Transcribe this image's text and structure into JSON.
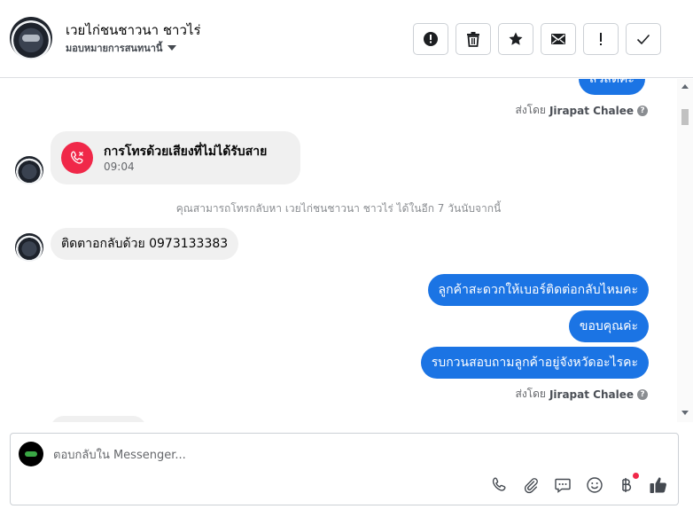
{
  "header": {
    "contact_name": "เวยไก่ชนชาวนา ชาวไร่",
    "assignee_label": "มอบหมายการสนทนานี้",
    "toolbar": [
      {
        "name": "report-button",
        "icon": "alert-circle-icon"
      },
      {
        "name": "delete-button",
        "icon": "trash-icon"
      },
      {
        "name": "star-button",
        "icon": "star-icon"
      },
      {
        "name": "mark-unread-button",
        "icon": "envelope-icon"
      },
      {
        "name": "follow-up-button",
        "icon": "exclamation-icon"
      },
      {
        "name": "mark-done-button",
        "icon": "check-icon"
      }
    ]
  },
  "conversation": {
    "top_partial_bubble": "สวัสดีค่ะ",
    "sent_by_prefix": "ส่งโดย",
    "sent_by_name": "Jirapat Chalee",
    "missed_call": {
      "title": "การโทรด้วยเสียงที่ไม่ได้รับสาย",
      "time": "09:04"
    },
    "callback_note": "คุณสามารถโทรกลับหา เวยไก่ชนชาวนา ชาวไร่ ได้ในอีก 7 วันนับจากนี้",
    "incoming_message": "ติดตาอกลับด้วย 0973133383",
    "outgoing_messages": [
      "ลูกค้าสะดวกให้เบอร์ติดต่อกลับไหมคะ",
      "ขอบคุณค่ะ",
      "รบกวนสอบถามลูกค้าอยู่จังหวัดอะไรคะ"
    ]
  },
  "composer": {
    "placeholder": "ตอบกลับใน Messenger...",
    "value": "",
    "tools": [
      "phone-icon",
      "paperclip-icon",
      "saved-replies-icon",
      "emoji-icon",
      "baht-payment-icon",
      "thumbs-up-icon"
    ]
  },
  "colors": {
    "brand_blue": "#1b74e4",
    "missed_call_red": "#f02849",
    "incoming_bubble": "#f0f0f0"
  }
}
